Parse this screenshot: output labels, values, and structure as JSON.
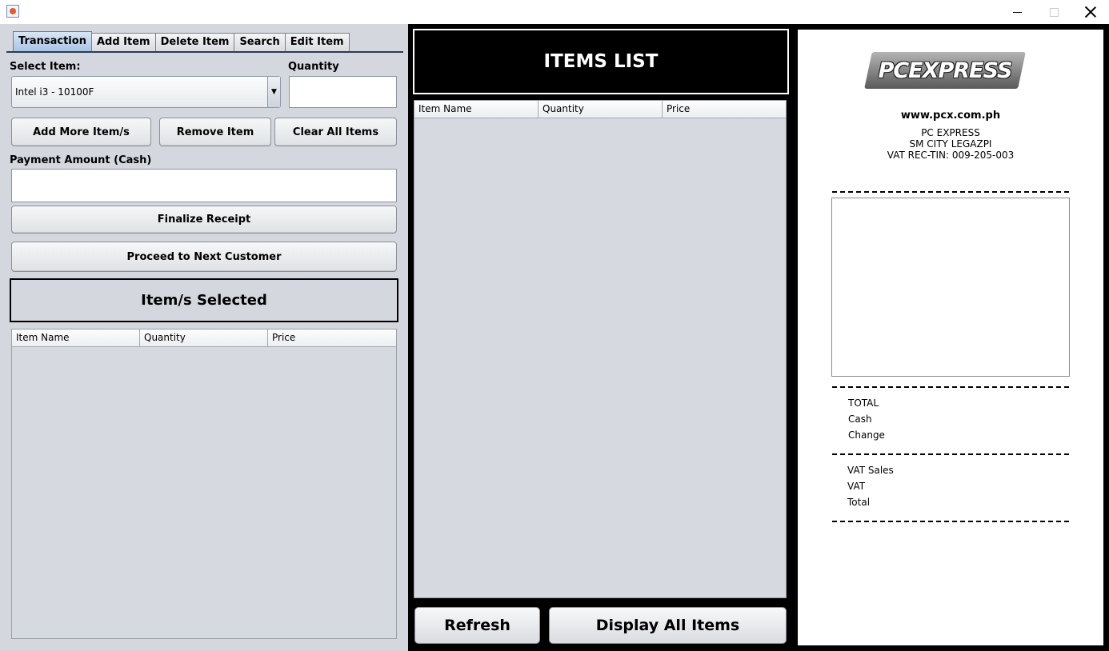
{
  "tabs": [
    "Transaction",
    "Add Item",
    "Delete Item",
    "Search",
    "Edit Item"
  ],
  "transaction": {
    "select_item_label": "Select Item:",
    "selected_item": "Intel i3 - 10100F",
    "quantity_label": "Quantity",
    "quantity_value": "",
    "add_more_label": "Add More Item/s",
    "remove_item_label": "Remove Item",
    "clear_all_label": "Clear All Items",
    "payment_label": "Payment Amount (Cash)",
    "payment_value": "",
    "finalize_label": "Finalize Receipt",
    "proceed_label": "Proceed to Next Customer",
    "selected_heading": "Item/s Selected",
    "selected_columns": [
      "Item Name",
      "Quantity",
      "Price"
    ],
    "selected_rows": []
  },
  "items_list": {
    "title": "ITEMS LIST",
    "columns": [
      "Item Name",
      "Quantity",
      "Price"
    ],
    "rows": [],
    "refresh_label": "Refresh",
    "display_all_label": "Display All Items"
  },
  "receipt": {
    "logo_text": "PCEXPRESS",
    "website": "www.pcx.com.ph",
    "store_name": "PC EXPRESS",
    "branch": "SM CITY LEGAZPI",
    "tin": "VAT REC-TIN: 009-205-003",
    "totals": [
      "TOTAL",
      "Cash",
      "Change"
    ],
    "vat_lines": [
      "VAT Sales",
      "VAT",
      "Total"
    ]
  },
  "colors": {
    "panel_bg": "#d4d7dd",
    "active_tab": "#a9c4e4",
    "dark_panel": "#000000",
    "receipt_bg": "#ffffff"
  }
}
